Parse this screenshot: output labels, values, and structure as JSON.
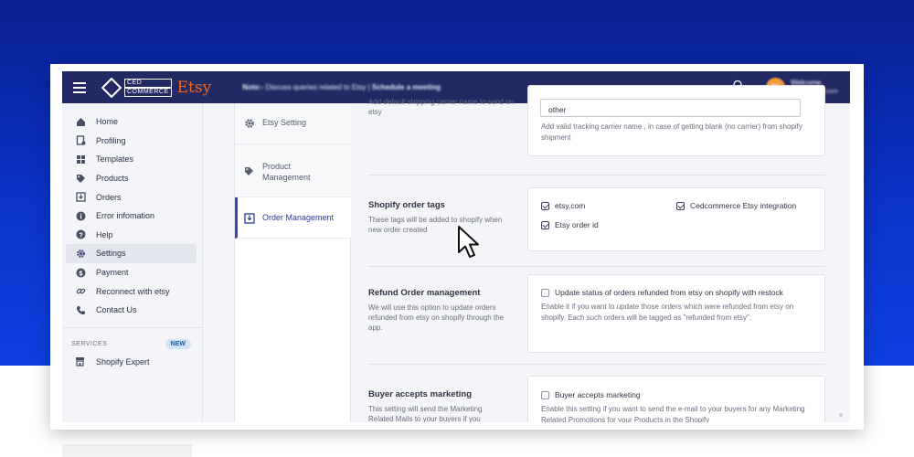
{
  "topbar": {
    "logo_line1": "CED",
    "logo_line2": "COMMERCE",
    "logo_brand": "Etsy",
    "note_label": "Note:-",
    "note_text": "Discuss queries related to Etsy |",
    "note_link": "Schedule a meeting",
    "avatar_initials": "TN",
    "welcome_title": "Welcome,",
    "welcome_sub": "testwithcedi.com"
  },
  "sidebar": {
    "items": [
      {
        "label": "Home",
        "icon": "home-icon"
      },
      {
        "label": "Profiling",
        "icon": "profiling-icon"
      },
      {
        "label": "Templates",
        "icon": "templates-icon"
      },
      {
        "label": "Products",
        "icon": "tag-icon"
      },
      {
        "label": "Orders",
        "icon": "orders-icon"
      },
      {
        "label": "Error infomation",
        "icon": "info-icon"
      },
      {
        "label": "Help",
        "icon": "help-icon"
      },
      {
        "label": "Settings",
        "icon": "gear-icon",
        "active": true
      },
      {
        "label": "Payment",
        "icon": "dollar-icon"
      },
      {
        "label": "Reconnect with etsy",
        "icon": "link-icon"
      },
      {
        "label": "Contact Us",
        "icon": "phone-icon"
      }
    ],
    "services_label": "SERVICES",
    "new_badge": "NEW",
    "services_item": "Shopify Expert"
  },
  "submenu": {
    "items": [
      {
        "label": "Etsy Setting",
        "icon": "gear-icon"
      },
      {
        "label": "Product Management",
        "icon": "tag-icon"
      },
      {
        "label": "Order Management",
        "icon": "download-box-icon",
        "active": true
      }
    ]
  },
  "settings": {
    "carrier": {
      "faded_desc": "Add default shipping carrier name to send on etsy",
      "input_value": "other",
      "help": "Add valid tracking carrier name , in case of getting blank (no carrier) from shopify shipment"
    },
    "order_tags": {
      "title": "Shopify order tags",
      "desc": "These tags will be added to shopify when new order created",
      "opt_etsy_com": "etsy.com",
      "opt_cedcommerce": "Cedcommerce Etsy integration",
      "opt_order_id": "Etsy order id"
    },
    "refund": {
      "title": "Refund Order management",
      "desc": "We will use this option to update orders refunded from etsy on shopify through the app.",
      "opt_label": "Update status of orders refunded from etsy on shopify with restock",
      "help": "Enable it if you want to update those orders which were refunded from etsy on shopify. Each such orders will be tagged as \"refunded from etsy\"."
    },
    "marketing": {
      "title": "Buyer accepts marketing",
      "desc": "This setting will send the Marketing Related Mails to your buyers if you",
      "opt_label": "Buyer accepts marketing",
      "help": "Enable this setting if you want to send the e-mail to your buyers for any Marketing Related Promotions for your Products in the Shopify"
    }
  }
}
